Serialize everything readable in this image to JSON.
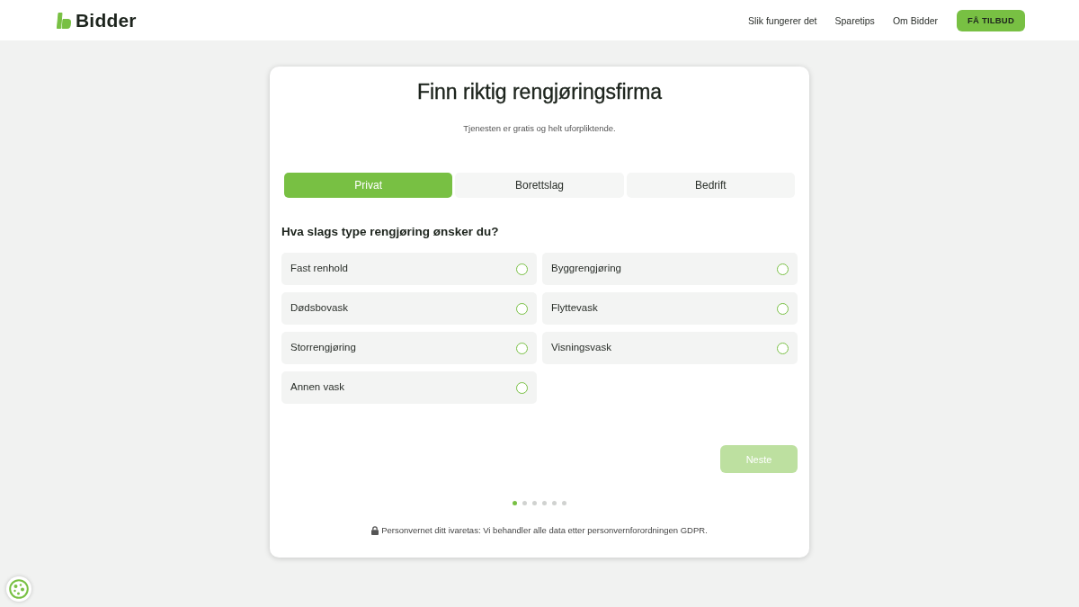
{
  "header": {
    "logo": "Bidder",
    "nav": [
      "Slik fungerer det",
      "Sparetips",
      "Om Bidder"
    ],
    "cta": "FÅ TILBUD"
  },
  "card": {
    "title": "Finn riktig rengjøringsfirma",
    "subtitle": "Tjenesten er gratis og helt uforpliktende.",
    "tabs": [
      {
        "label": "Privat",
        "selected": true
      },
      {
        "label": "Borettslag",
        "selected": false
      },
      {
        "label": "Bedrift",
        "selected": false
      }
    ],
    "question": "Hva slags type rengjøring ønsker du?",
    "options": [
      {
        "label": "Fast renhold",
        "selected": false
      },
      {
        "label": "Byggrengjøring",
        "selected": false
      },
      {
        "label": "Dødsbovask",
        "selected": false
      },
      {
        "label": "Flyttevask",
        "selected": false
      },
      {
        "label": "Storrengjøring",
        "selected": false
      },
      {
        "label": "Visningsvask",
        "selected": false
      },
      {
        "label": "Annen vask",
        "selected": false
      }
    ],
    "next_button": {
      "label": "Neste",
      "disabled": true
    },
    "steps": [
      {
        "selected": true
      },
      {
        "selected": false
      },
      {
        "selected": false
      },
      {
        "selected": false
      },
      {
        "selected": false
      },
      {
        "selected": false
      }
    ],
    "privacy": "Personvernet ditt ivaretas: Vi behandler alle data etter personvernforordningen GDPR."
  }
}
